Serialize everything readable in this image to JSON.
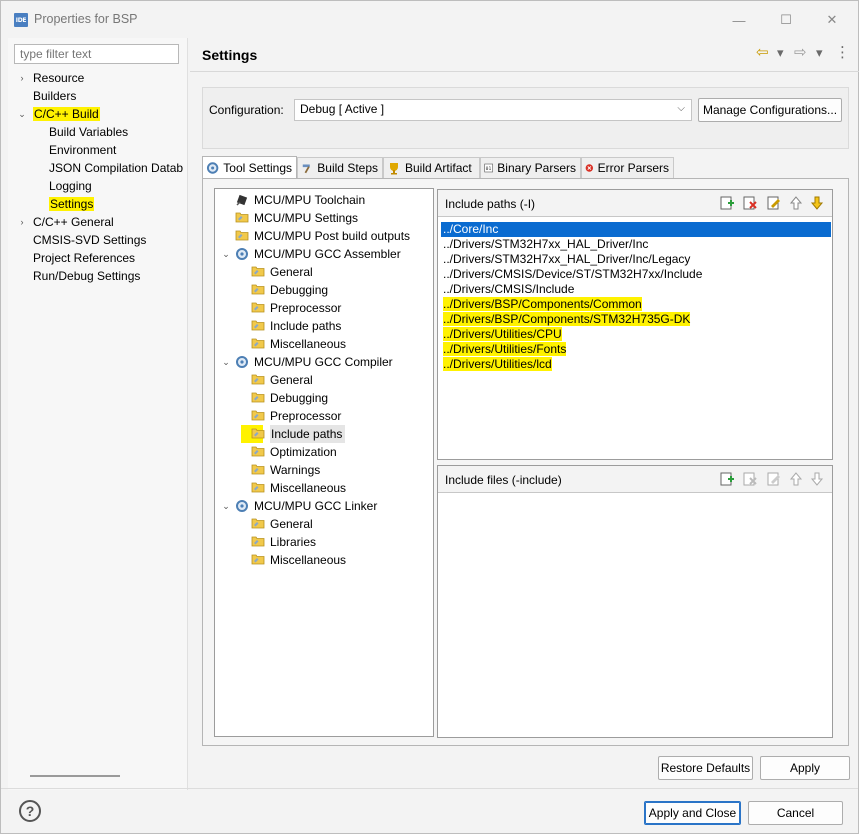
{
  "window": {
    "app_icon_text": "IDE",
    "title": "Properties for BSP",
    "minimize": "—",
    "maximize": "☐",
    "close": "✕"
  },
  "left": {
    "filter_placeholder": "type filter text",
    "tree": [
      {
        "label": "Resource",
        "twisty": "›",
        "level": 0
      },
      {
        "label": "Builders",
        "twisty": "",
        "level": 0
      },
      {
        "label": "C/C++ Build",
        "twisty": "⌄",
        "level": 0,
        "highlighted": true
      },
      {
        "label": "Build Variables",
        "twisty": "",
        "level": 1
      },
      {
        "label": "Environment",
        "twisty": "",
        "level": 1
      },
      {
        "label": "JSON Compilation Datab",
        "twisty": "",
        "level": 1
      },
      {
        "label": "Logging",
        "twisty": "",
        "level": 1
      },
      {
        "label": "Settings",
        "twisty": "",
        "level": 1,
        "highlighted": true,
        "selected": true
      },
      {
        "label": "C/C++ General",
        "twisty": "›",
        "level": 0
      },
      {
        "label": "CMSIS-SVD Settings",
        "twisty": "",
        "level": 0
      },
      {
        "label": "Project References",
        "twisty": "",
        "level": 0
      },
      {
        "label": "Run/Debug Settings",
        "twisty": "",
        "level": 0
      }
    ]
  },
  "header": {
    "title": "Settings",
    "back_icon": "⇦",
    "forward_icon": "⇨",
    "dropdown_icon": "▾",
    "menu_icon": "⋮"
  },
  "config": {
    "label": "Configuration:",
    "value": "Debug  [ Active ]",
    "manage_button": "Manage Configurations..."
  },
  "tabs": [
    {
      "label": "Tool Settings",
      "active": true
    },
    {
      "label": "Build Steps"
    },
    {
      "label": "Build Artifact"
    },
    {
      "label": "Binary Parsers"
    },
    {
      "label": "Error Parsers"
    }
  ],
  "tool_tree": [
    {
      "label": "MCU/MPU Toolchain",
      "icon": "chip"
    },
    {
      "label": "MCU/MPU Settings",
      "icon": "folder"
    },
    {
      "label": "MCU/MPU Post build outputs",
      "icon": "folder"
    },
    {
      "label": "MCU/MPU GCC Assembler",
      "icon": "gear",
      "expanded": true
    },
    {
      "label": "General",
      "icon": "folder",
      "child": true
    },
    {
      "label": "Debugging",
      "icon": "folder",
      "child": true
    },
    {
      "label": "Preprocessor",
      "icon": "folder",
      "child": true
    },
    {
      "label": "Include paths",
      "icon": "folder",
      "child": true
    },
    {
      "label": "Miscellaneous",
      "icon": "folder",
      "child": true
    },
    {
      "label": "MCU/MPU GCC Compiler",
      "icon": "gear",
      "expanded": true
    },
    {
      "label": "General",
      "icon": "folder",
      "child": true
    },
    {
      "label": "Debugging",
      "icon": "folder",
      "child": true
    },
    {
      "label": "Preprocessor",
      "icon": "folder",
      "child": true
    },
    {
      "label": "Include paths",
      "icon": "folder",
      "child": true,
      "selected": true,
      "highlighted": true
    },
    {
      "label": "Optimization",
      "icon": "folder",
      "child": true
    },
    {
      "label": "Warnings",
      "icon": "folder",
      "child": true
    },
    {
      "label": "Miscellaneous",
      "icon": "folder",
      "child": true
    },
    {
      "label": "MCU/MPU GCC Linker",
      "icon": "gear",
      "expanded": true
    },
    {
      "label": "General",
      "icon": "folder",
      "child": true
    },
    {
      "label": "Libraries",
      "icon": "folder",
      "child": true
    },
    {
      "label": "Miscellaneous",
      "icon": "folder",
      "child": true
    }
  ],
  "include_paths": {
    "title": "Include paths (-I)",
    "items": [
      {
        "path": "../Core/Inc",
        "selected": true
      },
      {
        "path": "../Drivers/STM32H7xx_HAL_Driver/Inc"
      },
      {
        "path": "../Drivers/STM32H7xx_HAL_Driver/Inc/Legacy"
      },
      {
        "path": "../Drivers/CMSIS/Device/ST/STM32H7xx/Include"
      },
      {
        "path": "../Drivers/CMSIS/Include"
      },
      {
        "path": "../Drivers/BSP/Components/Common",
        "highlighted": true
      },
      {
        "path": "../Drivers/BSP/Components/STM32H735G-DK",
        "highlighted": true
      },
      {
        "path": "../Drivers/Utilities/CPU",
        "highlighted": true
      },
      {
        "path": "../Drivers/Utilities/Fonts",
        "highlighted": true
      },
      {
        "path": "../Drivers/Utilities/lcd",
        "highlighted": true
      }
    ]
  },
  "include_files": {
    "title": "Include files (-include)"
  },
  "buttons": {
    "restore_defaults": "Restore Defaults",
    "apply": "Apply",
    "apply_and_close": "Apply and Close",
    "cancel": "Cancel",
    "help": "?"
  },
  "colors": {
    "highlight": "#fff200",
    "selection": "#0a6bd0",
    "accent": "#2a74c7"
  }
}
